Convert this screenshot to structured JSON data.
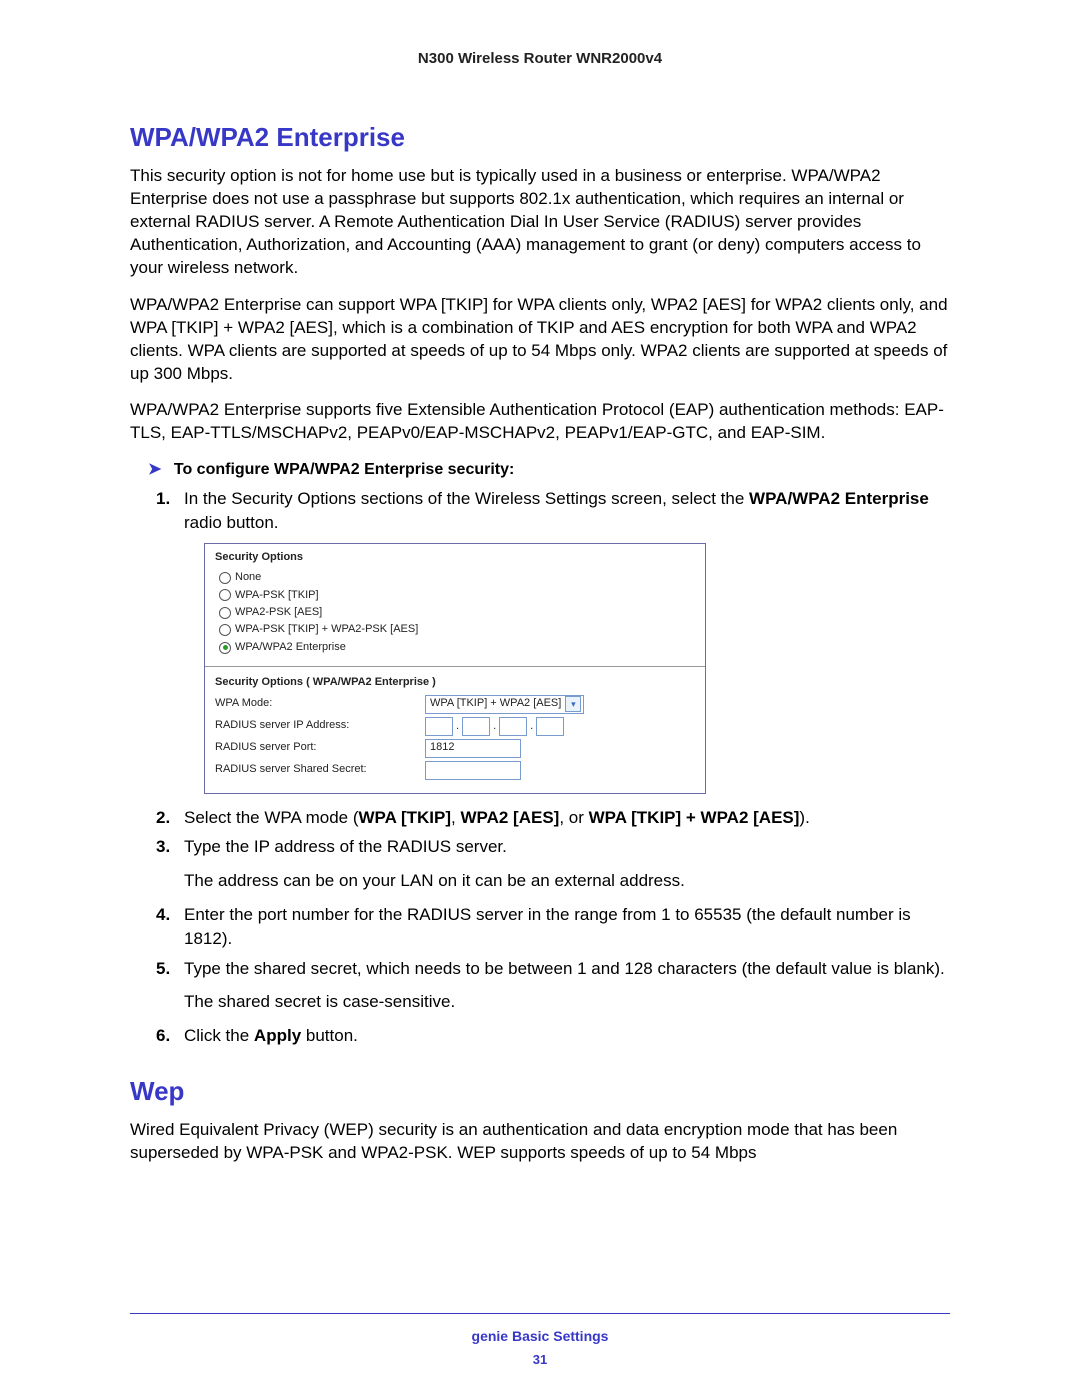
{
  "header": {
    "title": "N300 Wireless Router WNR2000v4"
  },
  "section1": {
    "title": "WPA/WPA2 Enterprise",
    "para1": "This security option is not for home use but is typically used in a business or enterprise. WPA/WPA2 Enterprise does not use a passphrase but supports 802.1x authentication, which requires an internal or external RADIUS server. A Remote Authentication Dial In User Service (RADIUS) server provides Authentication, Authorization, and Accounting (AAA) management to grant (or deny) computers access to your wireless network.",
    "para2": "WPA/WPA2 Enterprise can support WPA [TKIP] for WPA clients only, WPA2 [AES] for WPA2 clients only, and WPA [TKIP] + WPA2 [AES], which is a combination of TKIP and AES encryption for both WPA and WPA2 clients. WPA clients are supported at speeds of up to 54 Mbps only. WPA2 clients are supported at speeds of up 300 Mbps.",
    "para3": "WPA/WPA2 Enterprise supports five Extensible Authentication Protocol (EAP) authentication methods: EAP-TLS, EAP-TTLS/MSCHAPv2, PEAPv0/EAP-MSCHAPv2, PEAPv1/EAP-GTC, and EAP-SIM.",
    "task_title": "To configure WPA/WPA2 Enterprise security:"
  },
  "steps": {
    "s1a": "In the Security Options sections of the Wireless Settings screen, select the ",
    "s1b": "WPA/WPA2 Enterprise",
    "s1c": " radio button.",
    "s2a": "Select the WPA mode (",
    "s2b": "WPA [TKIP]",
    "s2c": ", ",
    "s2d": "WPA2 [AES]",
    "s2e": ", or ",
    "s2f": "WPA [TKIP] + WPA2 [AES]",
    "s2g": ").",
    "s3": "Type the IP address of the RADIUS server.",
    "s3_sub": "The address can be on your LAN on it can be an external address.",
    "s4": "Enter the port number for the RADIUS server in the range from 1 to 65535 (the default number is 1812).",
    "s5": "Type the shared secret, which needs to be between 1 and 128 characters (the default value is blank).",
    "s5_sub": "The shared secret is case-sensitive.",
    "s6a": "Click the ",
    "s6b": "Apply",
    "s6c": " button."
  },
  "fig": {
    "title": "Security Options",
    "opt_none": "None",
    "opt_wpa_tkip": "WPA-PSK [TKIP]",
    "opt_wpa2_aes": "WPA2-PSK [AES]",
    "opt_combo": "WPA-PSK [TKIP] + WPA2-PSK [AES]",
    "opt_ent": "WPA/WPA2 Enterprise",
    "sub_title": "Security Options ( WPA/WPA2 Enterprise )",
    "l_mode": "WPA Mode:",
    "v_mode": "WPA [TKIP] + WPA2 [AES]",
    "l_ip": "RADIUS server IP Address:",
    "l_port": "RADIUS server Port:",
    "v_port": "1812",
    "l_secret": "RADIUS server Shared Secret:"
  },
  "section2": {
    "title": "Wep",
    "para1": "Wired Equivalent Privacy (WEP) security is an authentication and data encryption mode that has been superseded by WPA-PSK and WPA2-PSK. WEP supports speeds of up to 54 Mbps"
  },
  "footer": {
    "title": "genie Basic Settings",
    "page": "31"
  }
}
